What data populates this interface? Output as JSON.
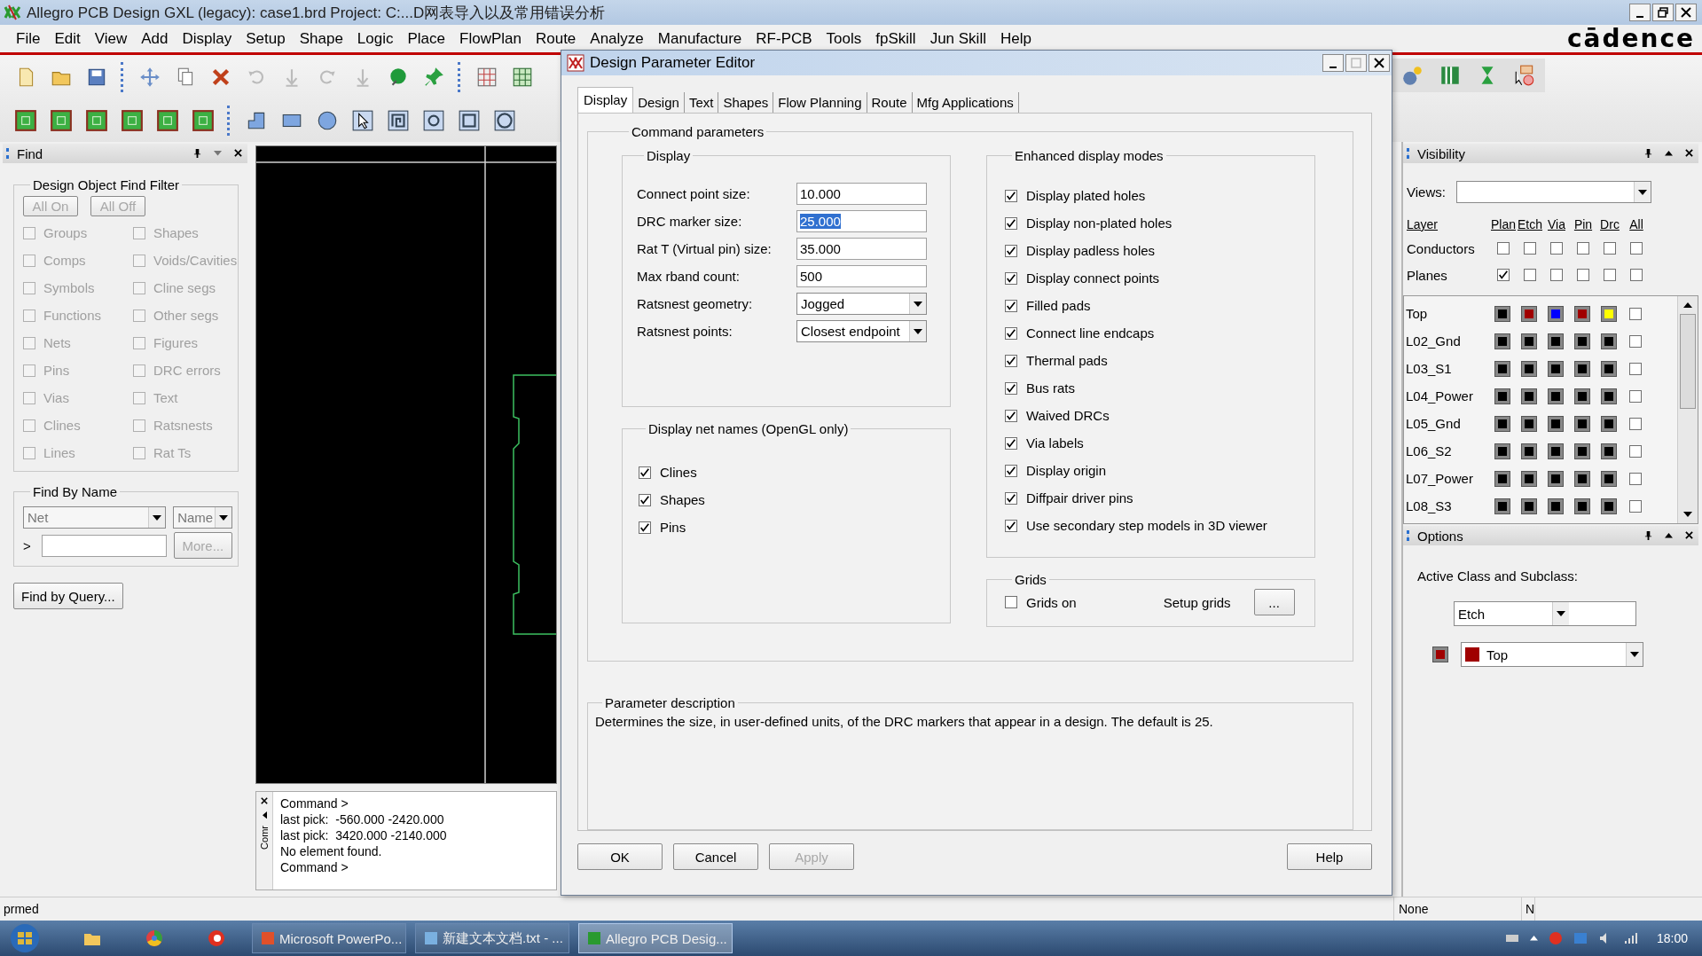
{
  "window": {
    "title": "Allegro PCB Design GXL (legacy): case1.brd  Project: C:...D网表导入以及常用错误分析"
  },
  "menu": [
    "File",
    "Edit",
    "View",
    "Add",
    "Display",
    "Setup",
    "Shape",
    "Logic",
    "Place",
    "FlowPlan",
    "Route",
    "Analyze",
    "Manufacture",
    "RF-PCB",
    "Tools",
    "fpSkill",
    "Jun Skill",
    "Help"
  ],
  "brand": "cādence",
  "find_panel": {
    "title": "Find",
    "filter": {
      "title": "Design Object Find Filter",
      "buttons": [
        {
          "label": "All On",
          "disabled": true
        },
        {
          "label": "All Off",
          "disabled": true
        }
      ],
      "items": [
        {
          "label": "Groups",
          "checked": false,
          "disabled": true
        },
        {
          "label": "Shapes",
          "checked": false,
          "disabled": true
        },
        {
          "label": "Comps",
          "checked": false,
          "disabled": true
        },
        {
          "label": "Voids/Cavities",
          "checked": false,
          "disabled": true
        },
        {
          "label": "Symbols",
          "checked": false,
          "disabled": true
        },
        {
          "label": "Cline segs",
          "checked": false,
          "disabled": true
        },
        {
          "label": "Functions",
          "checked": false,
          "disabled": true
        },
        {
          "label": "Other segs",
          "checked": false,
          "disabled": true
        },
        {
          "label": "Nets",
          "checked": false,
          "disabled": true
        },
        {
          "label": "Figures",
          "checked": false,
          "disabled": true
        },
        {
          "label": "Pins",
          "checked": false,
          "disabled": true
        },
        {
          "label": "DRC errors",
          "checked": false,
          "disabled": true
        },
        {
          "label": "Vias",
          "checked": false,
          "disabled": true
        },
        {
          "label": "Text",
          "checked": false,
          "disabled": true
        },
        {
          "label": "Clines",
          "checked": false,
          "disabled": true
        },
        {
          "label": "Ratsnests",
          "checked": false,
          "disabled": true
        },
        {
          "label": "Lines",
          "checked": false,
          "disabled": true
        },
        {
          "label": "Rat Ts",
          "checked": false,
          "disabled": true
        }
      ]
    },
    "by_name": {
      "title": "Find By Name",
      "type": "Net",
      "mode": "Name",
      "prompt": ">",
      "more": {
        "label": "More...",
        "disabled": true
      }
    },
    "query_button": "Find by Query..."
  },
  "command": {
    "tab": "Comr",
    "lines": [
      "Command >",
      "last pick:  -560.000 -2420.000",
      "last pick:  3420.000 -2140.000",
      "No element found.",
      "Command >"
    ]
  },
  "dialog": {
    "title": "Design Parameter Editor",
    "tabs": [
      {
        "label": "Display",
        "selected": true
      },
      {
        "label": "Design",
        "selected": false
      },
      {
        "label": "Text",
        "selected": false
      },
      {
        "label": "Shapes",
        "selected": false
      },
      {
        "label": "Flow Planning",
        "selected": false
      },
      {
        "label": "Route",
        "selected": false
      },
      {
        "label": "Mfg Applications",
        "selected": false
      }
    ],
    "group_title": "Command parameters",
    "display": {
      "title": "Display",
      "fields": [
        {
          "label": "Connect point size:",
          "value": "10.000",
          "kind": "text",
          "selected": false
        },
        {
          "label": "DRC marker size:",
          "value": "25.000",
          "kind": "text",
          "selected": true
        },
        {
          "label": "Rat T (Virtual pin) size:",
          "value": "35.000",
          "kind": "text",
          "selected": false
        },
        {
          "label": "Max rband count:",
          "value": "500",
          "kind": "text",
          "selected": false
        },
        {
          "label": "Ratsnest geometry:",
          "value": "Jogged",
          "kind": "dropdown",
          "selected": false
        },
        {
          "label": "Ratsnest points:",
          "value": "Closest endpoint",
          "kind": "dropdown",
          "selected": false
        }
      ]
    },
    "net_names": {
      "title": "Display net names (OpenGL only)",
      "items": [
        {
          "label": "Clines",
          "checked": true
        },
        {
          "label": "Shapes",
          "checked": true
        },
        {
          "label": "Pins",
          "checked": true
        }
      ]
    },
    "enhanced": {
      "title": "Enhanced display modes",
      "items": [
        {
          "label": "Display plated holes",
          "checked": true
        },
        {
          "label": "Display non-plated holes",
          "checked": true
        },
        {
          "label": "Display padless holes",
          "checked": true
        },
        {
          "label": "Display connect points",
          "checked": true
        },
        {
          "label": "Filled pads",
          "checked": true
        },
        {
          "label": "Connect line endcaps",
          "checked": true
        },
        {
          "label": "Thermal pads",
          "checked": true
        },
        {
          "label": "Bus rats",
          "checked": true
        },
        {
          "label": "Waived DRCs",
          "checked": true
        },
        {
          "label": "Via labels",
          "checked": true
        },
        {
          "label": "Display origin",
          "checked": true
        },
        {
          "label": "Diffpair driver pins",
          "checked": true
        },
        {
          "label": "Use secondary step models in 3D viewer",
          "checked": true
        }
      ]
    },
    "grids": {
      "title": "Grids",
      "grids_on": {
        "label": "Grids on",
        "checked": false
      },
      "setup_label": "Setup grids",
      "setup_button": "..."
    },
    "description": {
      "title": "Parameter description",
      "text": "Determines the size, in user-defined units, of the DRC markers that appear in a design. The default is 25."
    },
    "buttons": [
      {
        "label": "OK",
        "disabled": false
      },
      {
        "label": "Cancel",
        "disabled": false
      },
      {
        "label": "Apply",
        "disabled": true
      },
      {
        "label": "Help",
        "disabled": false
      }
    ]
  },
  "visibility": {
    "title": "Visibility",
    "views_label": "Views:",
    "columns": [
      "Layer",
      "Plan",
      "Etch",
      "Via",
      "Pin",
      "Drc",
      "All"
    ],
    "groups": [
      {
        "name": "Conductors",
        "checks": [
          false,
          false,
          false,
          false,
          false,
          false
        ]
      },
      {
        "name": "Planes",
        "checks": [
          true,
          false,
          false,
          false,
          false,
          false
        ]
      }
    ],
    "layers": [
      {
        "name": "Top",
        "swatches": [
          {
            "color": "#000000"
          },
          {
            "color": "#a00000"
          },
          {
            "color": "#0000ff"
          },
          {
            "color": "#a00000"
          },
          {
            "color": "#ffff00"
          }
        ],
        "all": false
      },
      {
        "name": "L02_Gnd",
        "swatches": [
          {
            "color": "#000000"
          },
          {
            "color": "#000000"
          },
          {
            "color": "#000000"
          },
          {
            "color": "#000000"
          },
          {
            "color": "#000000"
          }
        ],
        "all": false
      },
      {
        "name": "L03_S1",
        "swatches": [
          {
            "color": "#000000"
          },
          {
            "color": "#000000"
          },
          {
            "color": "#000000"
          },
          {
            "color": "#000000"
          },
          {
            "color": "#000000"
          }
        ],
        "all": false
      },
      {
        "name": "L04_Power",
        "swatches": [
          {
            "color": "#000000"
          },
          {
            "color": "#000000"
          },
          {
            "color": "#000000"
          },
          {
            "color": "#000000"
          },
          {
            "color": "#000000"
          }
        ],
        "all": false
      },
      {
        "name": "L05_Gnd",
        "swatches": [
          {
            "color": "#000000"
          },
          {
            "color": "#000000"
          },
          {
            "color": "#000000"
          },
          {
            "color": "#000000"
          },
          {
            "color": "#000000"
          }
        ],
        "all": false
      },
      {
        "name": "L06_S2",
        "swatches": [
          {
            "color": "#000000"
          },
          {
            "color": "#000000"
          },
          {
            "color": "#000000"
          },
          {
            "color": "#000000"
          },
          {
            "color": "#000000"
          }
        ],
        "all": false
      },
      {
        "name": "L07_Power",
        "swatches": [
          {
            "color": "#000000"
          },
          {
            "color": "#000000"
          },
          {
            "color": "#000000"
          },
          {
            "color": "#000000"
          },
          {
            "color": "#000000"
          }
        ],
        "all": false
      },
      {
        "name": "L08_S3",
        "swatches": [
          {
            "color": "#000000"
          },
          {
            "color": "#000000"
          },
          {
            "color": "#000000"
          },
          {
            "color": "#000000"
          },
          {
            "color": "#000000"
          }
        ],
        "all": false
      }
    ]
  },
  "options": {
    "title": "Options",
    "label": "Active Class and Subclass:",
    "class": "Etch",
    "subclass": {
      "name": "Top",
      "color": "#a00000"
    }
  },
  "status_bar": [
    "prmed",
    "None",
    "N"
  ],
  "taskbar": {
    "items": [
      {
        "label": "Microsoft PowerPo...",
        "selected": false
      },
      {
        "label": "新建文本文档.txt - ...",
        "selected": false
      },
      {
        "label": "Allegro PCB Desig...",
        "selected": true
      }
    ],
    "clock": "18:00"
  }
}
